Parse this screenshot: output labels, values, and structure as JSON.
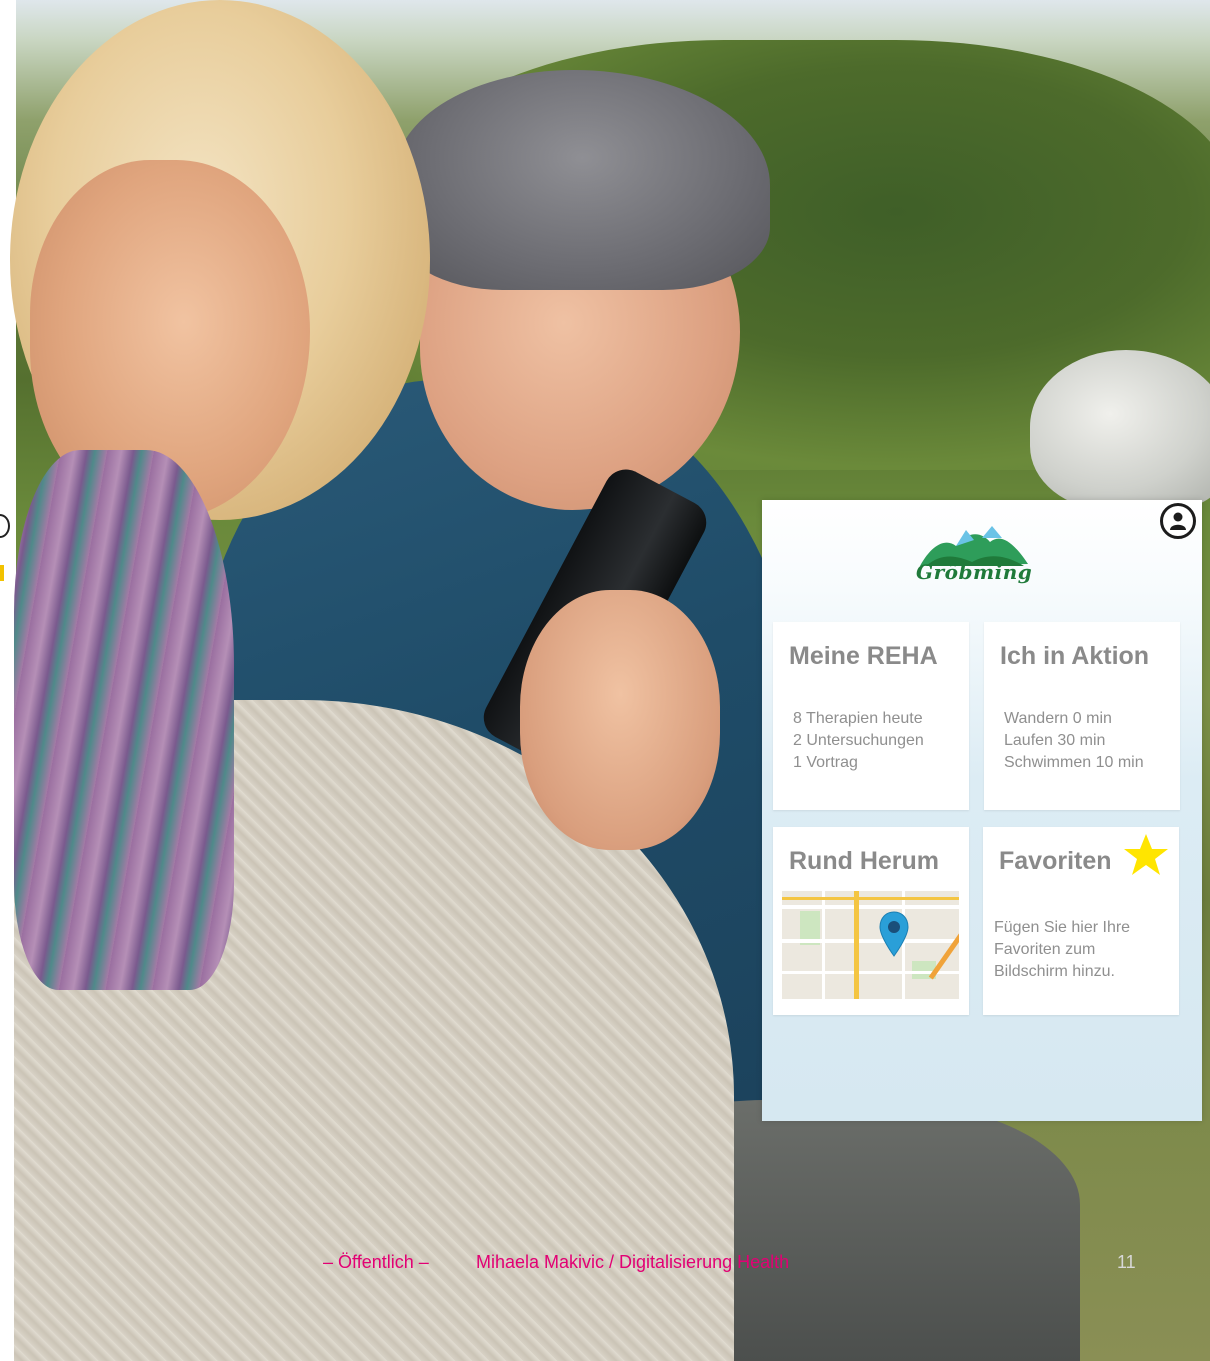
{
  "background": {
    "description_icon": "photo-couple-with-smartphone"
  },
  "app": {
    "logo": {
      "text": "Gröbming",
      "icon": "mountain-logo-icon"
    },
    "profile_icon": "user-profile-icon",
    "tiles": [
      {
        "title": "Meine REHA",
        "lines": [
          "8 Therapien heute",
          "2 Untersuchungen",
          "1 Vortrag"
        ]
      },
      {
        "title": "Ich in Aktion",
        "lines": [
          "Wandern 0 min",
          "Laufen 30 min",
          "Schwimmen 10 min"
        ]
      },
      {
        "title": "Rund Herum",
        "map_icon": "map-preview",
        "pin_icon": "location-pin-icon"
      },
      {
        "title": "Favoriten",
        "star_icon": "star-icon",
        "lines": [
          "Fügen Sie hier Ihre",
          "Favoriten zum",
          "Bildschirm hinzu."
        ]
      }
    ]
  },
  "footer": {
    "classification": "– Öffentlich –",
    "author": "Mihaela Makivic / Digitalisierung Health",
    "page_number": "11"
  },
  "colors": {
    "brand_magenta": "#e20074",
    "tile_text": "#8a8a8a",
    "logo_green": "#1f7a3a",
    "star_yellow": "#ffe500",
    "pin_blue": "#2a9fd8"
  }
}
